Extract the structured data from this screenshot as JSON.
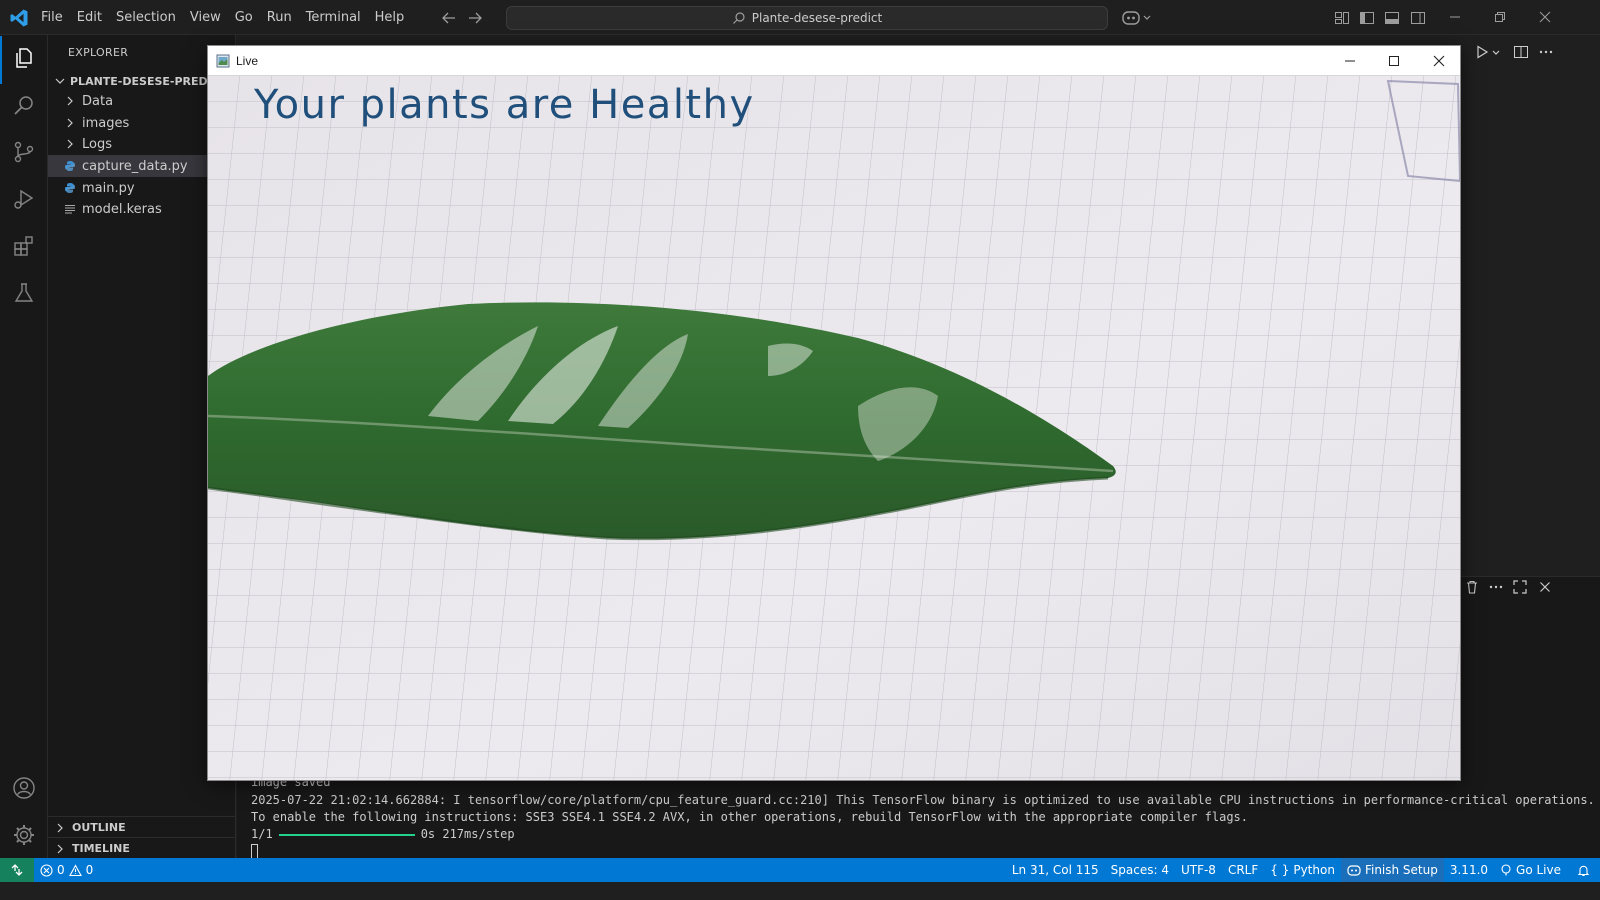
{
  "titlebar": {
    "menu": [
      "File",
      "Edit",
      "Selection",
      "View",
      "Go",
      "Run",
      "Terminal",
      "Help"
    ],
    "search_text": "Plante-desese-predict"
  },
  "explorer": {
    "title": "EXPLORER",
    "folder": "PLANTE-DESESE-PREDICT",
    "items": [
      {
        "label": "Data",
        "kind": "folder"
      },
      {
        "label": "images",
        "kind": "folder"
      },
      {
        "label": "Logs",
        "kind": "folder"
      },
      {
        "label": "capture_data.py",
        "kind": "python",
        "selected": true
      },
      {
        "label": "main.py",
        "kind": "python"
      },
      {
        "label": "model.keras",
        "kind": "file"
      }
    ],
    "outline": "OUTLINE",
    "timeline": "TIMELINE"
  },
  "terminal": {
    "line1": "image saved",
    "line2": "2025-07-22 21:02:14.662884: I tensorflow/core/platform/cpu_feature_guard.cc:210] This TensorFlow binary is optimized to use available CPU instructions in performance-critical operations.",
    "line3": "To enable the following instructions: SSE3 SSE4.1 SSE4.2 AVX, in other operations, rebuild TensorFlow with the appropriate compiler flags.",
    "step": "1/1",
    "step_result": "0s 217ms/step",
    "progress": 1.0
  },
  "statusbar": {
    "errors": "0",
    "warnings": "0",
    "position": "Ln 31, Col 115",
    "spaces": "Spaces: 4",
    "encoding": "UTF-8",
    "eol": "CRLF",
    "language": "Python",
    "finish_setup": "Finish Setup",
    "version": "3.11.0",
    "go_live": "Go Live"
  },
  "live_window": {
    "title": "Live",
    "overlay_text": "Your plants are Healthy"
  },
  "colors": {
    "accent": "#0078d4",
    "remote": "#16825d",
    "overlay_text": "#1f4f7a",
    "progress": "#23d18b"
  }
}
